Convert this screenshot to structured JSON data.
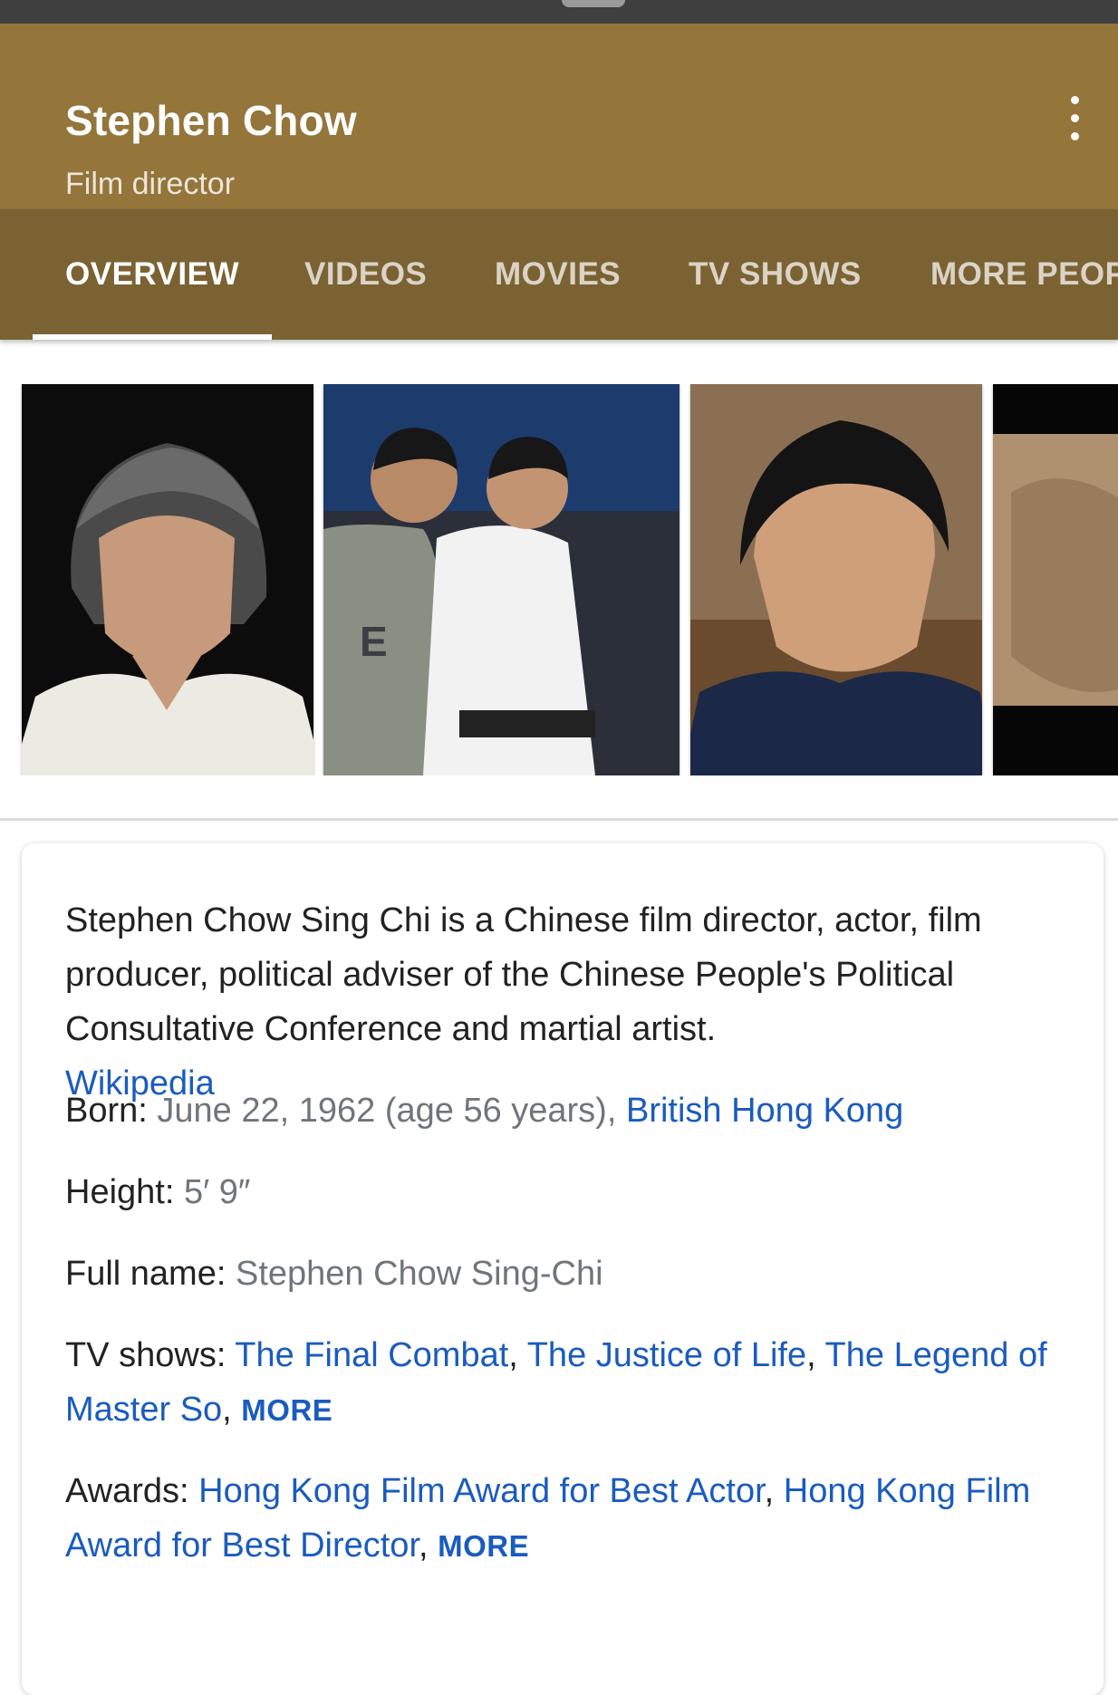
{
  "header": {
    "title": "Stephen Chow",
    "subtitle": "Film director",
    "menu_icon": "more-vert-icon"
  },
  "tabs": [
    {
      "label": "OVERVIEW",
      "active": true
    },
    {
      "label": "VIDEOS",
      "active": false
    },
    {
      "label": "MOVIES",
      "active": false
    },
    {
      "label": "TV SHOWS",
      "active": false
    },
    {
      "label": "MORE PEOPLE",
      "active": false
    }
  ],
  "photos": [
    {
      "subject": "portrait-white-shirt"
    },
    {
      "subject": "two-men-posing"
    },
    {
      "subject": "portrait-navy-shirt"
    },
    {
      "subject": "cropped-image"
    }
  ],
  "description": {
    "text": "Stephen Chow Sing Chi is a Chinese film director, actor, film producer, political adviser of the Chinese People's Political Consultative Conference and martial artist.",
    "source": "Wikipedia"
  },
  "facts": {
    "born": {
      "label": "Born:",
      "value": "June 22, 1962 (age 56 years)",
      "sep": ", ",
      "place": "British Hong Kong"
    },
    "height": {
      "label": "Height:",
      "value": "5′ 9″"
    },
    "full_name": {
      "label": "Full name:",
      "value": "Stephen Chow Sing-Chi"
    },
    "tv_shows": {
      "label": "TV shows:",
      "items": [
        "The Final Combat",
        "The Justice of Life",
        "The Legend of Master So"
      ],
      "sep": ", ",
      "more": "MORE"
    },
    "awards": {
      "label": "Awards:",
      "items": [
        "Hong Kong Film Award for Best Actor",
        "Hong Kong Film Award for Best Director"
      ],
      "sep": ", ",
      "more": "MORE"
    }
  },
  "colors": {
    "header_bg": "#94753a",
    "tabs_bg": "#7b6233",
    "link": "#1a5bbf",
    "value_text": "#70757a"
  }
}
